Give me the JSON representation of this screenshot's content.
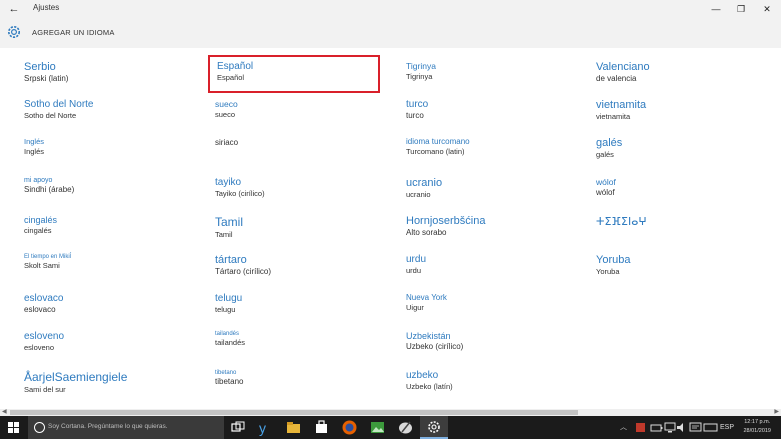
{
  "window": {
    "title": "Ajustes",
    "back_glyph": "←",
    "minimize_glyph": "—",
    "maximize_glyph": "❐",
    "close_glyph": "✕"
  },
  "header": {
    "label": "AGREGAR UN IDIOMA"
  },
  "languages": [
    {
      "name": "Serbio",
      "native": "Srpski (latin)"
    },
    {
      "name": "Español",
      "native": "Español",
      "selected": true
    },
    {
      "name": "Tigrinya",
      "native": "Tigrinya"
    },
    {
      "name": "Valenciano",
      "native": "de valencia"
    },
    {
      "name": "Sotho del Norte",
      "native": "Sotho del Norte"
    },
    {
      "name": "sueco",
      "native": "sueco"
    },
    {
      "name": "turco",
      "native": "turco"
    },
    {
      "name": "vietnamita",
      "native": "vietnamita"
    },
    {
      "name": "Inglés",
      "native": "Inglés"
    },
    {
      "name": "",
      "native": "siriaco"
    },
    {
      "name": "idioma turcomano",
      "native": "Turcomano (latin)"
    },
    {
      "name": "galés",
      "native": "galés"
    },
    {
      "name": "mi apoyo",
      "native": "Sindhi (árabe)"
    },
    {
      "name": "tayiko",
      "native": "Tayiko (cirílico)"
    },
    {
      "name": "ucranio",
      "native": "ucranio"
    },
    {
      "name": "wólof",
      "native": "wólof"
    },
    {
      "name": "cingalés",
      "native": "cingalés"
    },
    {
      "name": "Tamil",
      "native": "Tamil"
    },
    {
      "name": "Hornjoserbšćina",
      "native": "Alto sorabo"
    },
    {
      "name": "ⵜⵉⴼⵉⵏⴰⵖ",
      "native": ""
    },
    {
      "name": "El tiempo en Mikiĺ",
      "native": "Skolt Sami"
    },
    {
      "name": "tártaro",
      "native": "Tártaro (cirílico)"
    },
    {
      "name": "urdu",
      "native": "urdu"
    },
    {
      "name": "Yoruba",
      "native": "Yoruba"
    },
    {
      "name": "eslovaco",
      "native": "eslovaco"
    },
    {
      "name": "telugu",
      "native": "telugu"
    },
    {
      "name": "Nueva York",
      "native": "Uigur"
    },
    {
      "name": "",
      "native": ""
    },
    {
      "name": "esloveno",
      "native": "esloveno"
    },
    {
      "name": "tailandés",
      "native": "tailandés"
    },
    {
      "name": "Uzbekistán",
      "native": "Uzbeko (cirílico)"
    },
    {
      "name": "",
      "native": ""
    },
    {
      "name": "ÅarjelSaemiengiele",
      "native": "Sami del sur"
    },
    {
      "name": "tibetano",
      "native": "tibetano"
    },
    {
      "name": "uzbeko",
      "native": "Uzbeko (latín)"
    },
    {
      "name": "",
      "native": ""
    }
  ],
  "taskbar": {
    "search_placeholder": "Soy Cortana. Pregúntame lo que quieras.",
    "tray_text": "ESP",
    "clock_time": "12:17 p.m.",
    "clock_date": "28/01/2019"
  },
  "icons": {
    "back": "back-arrow-icon",
    "settings": "gear-icon",
    "start": "windows-start-icon",
    "cortana": "cortana-icon",
    "task_view": "task-view-icon"
  },
  "colors": {
    "accent": "#2f7bbf",
    "selected_border": "#d9202a",
    "taskbar": "#1b1b1b",
    "chrome": "#f2f2f2"
  }
}
